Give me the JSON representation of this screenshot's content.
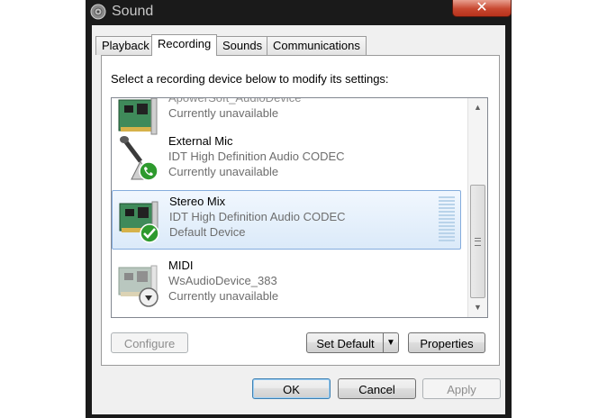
{
  "window": {
    "title": "Sound",
    "close_glyph": "✕"
  },
  "tabs": [
    "Playback",
    "Recording",
    "Sounds",
    "Communications"
  ],
  "active_tab": "Recording",
  "instruction": "Select a recording device below to modify its settings:",
  "devices": [
    {
      "name": "ApowerSoft_AudioDevice",
      "sub": "",
      "status": "Currently unavailable",
      "icon": "sound-card-icon"
    },
    {
      "name": "External Mic",
      "sub": "IDT High Definition Audio CODEC",
      "status": "Currently unavailable",
      "icon": "microphone-icon",
      "badge": "phone-badge-icon"
    },
    {
      "name": "Stereo Mix",
      "sub": "IDT High Definition Audio CODEC",
      "status": "Default Device",
      "icon": "sound-card-icon",
      "badge": "checkmark-badge-icon",
      "selected": true
    },
    {
      "name": "MIDI",
      "sub": "WsAudioDevice_383",
      "status": "Currently unavailable",
      "icon": "sound-card-icon",
      "badge": "down-arrow-badge-icon"
    }
  ],
  "buttons": {
    "configure": "Configure",
    "set_default": "Set Default",
    "properties": "Properties",
    "ok": "OK",
    "cancel": "Cancel",
    "apply": "Apply"
  },
  "colors": {
    "selection": "#dbeaf9",
    "selection_border": "#84acdd",
    "check_green": "#2e9a2e",
    "close_red": "#c7472f"
  }
}
